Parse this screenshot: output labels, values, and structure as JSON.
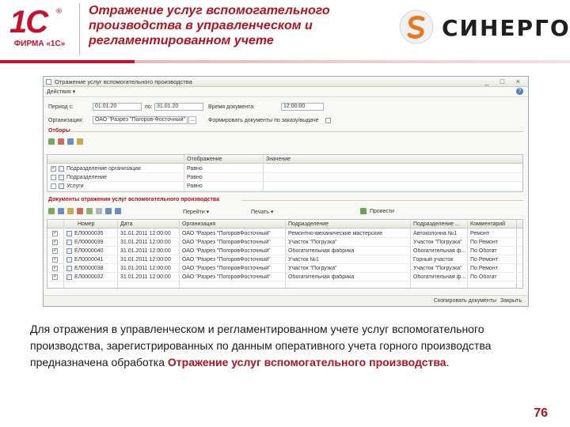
{
  "header": {
    "logo_1c": {
      "mark": "1С",
      "reg": "®",
      "firm": "ФИРМА «1С»"
    },
    "title": "Отражение услуг вспомогательного производства в управленческом и регламентированном учете",
    "partner_logo": "СИНЕРГО"
  },
  "window": {
    "title": "Отражение услуг вспомогательного производства",
    "controls": "_ □ ×",
    "menu_actions": "Действия ▾",
    "help": "?",
    "period_label": "Период с:",
    "period_from": "01.01.20",
    "period_to_label": "по:",
    "period_to": "31.01.20",
    "time_label": "Время документа:",
    "time_value": "12:00:00",
    "org_label": "Организация:",
    "org_value": "ОАО \"Разрез \"Погоров-Фосточный\"",
    "org_button": "...",
    "form_docs_label": "Формировать документы по заказу/выдаче",
    "selections_label": "Отборы",
    "filter_columns": [
      "",
      "Отображение",
      "Значение"
    ],
    "filters": [
      {
        "check": true,
        "name": "Подразделение организации",
        "cond": "Равно",
        "value": ""
      },
      {
        "check": false,
        "name": "Подразделение",
        "cond": "Равно",
        "value": ""
      },
      {
        "check": false,
        "name": "Услуги",
        "cond": "Равно",
        "value": ""
      }
    ],
    "docs_label": "Документы отражения услуг вспомогательного производства",
    "docs_toolbar_items": [
      "Перейти ▾",
      "Печать ▾",
      "Провести"
    ],
    "docs_columns": [
      "",
      "Номер",
      "Дата",
      "Организация",
      "Подразделение",
      "Подразделение ...",
      "Комментарий"
    ],
    "docs": [
      {
        "check": true,
        "number": "ЕЛ0000035",
        "date": "31.01.2011 12:00:00",
        "org": "ОАО \"Разрез \"ПогоровФосточный\"",
        "dept": "Ремонтно-механические мастерские",
        "dept2": "Автоколонна №1",
        "comment": "Ремонт"
      },
      {
        "check": true,
        "number": "ЕЛ0000039",
        "date": "31.01.2011 12:00:00",
        "org": "ОАО \"Разрез \"ПогоровФосточный\"",
        "dept": "Участок \"Погрузка\"",
        "dept2": "Участок \"Погрузка\"",
        "comment": "По Ремонт"
      },
      {
        "check": true,
        "number": "ЕЛ0000040",
        "date": "31.01.2011 12:00:00",
        "org": "ОАО \"Разрез \"ПогоровФосточный\"",
        "dept": "Обогатительная фабрика",
        "dept2": "Обогатительная ф...",
        "comment": "По Обогат"
      },
      {
        "check": true,
        "number": "ЕЛ0000041",
        "date": "31.01.2011 12:00:00",
        "org": "ОАО \"Разрез \"ПогоровФосточный\"",
        "dept": "Участок №1",
        "dept2": "Горный участок",
        "comment": "По Ремонт"
      },
      {
        "check": true,
        "number": "ЕЛ0000038",
        "date": "31.01.2011 12:00:00",
        "org": "ОАО \"Разрез \"ПогоровФосточный\"",
        "dept": "Участок \"Погрузка\"",
        "dept2": "Участок \"Погрузка\"",
        "comment": "По Ремонт"
      },
      {
        "check": true,
        "number": "ЕЛ0000032",
        "date": "31.01.2011 12:00:00",
        "org": "ОАО \"Разрез \"ПогоровФосточный\"",
        "dept": "Обогатительная фабрика",
        "dept2": "Обогатительная ф...",
        "comment": "По Обогат"
      }
    ],
    "copy_docs": "Скопировать документы",
    "close": "Закрыть"
  },
  "caption": {
    "text": "Для отражения в управленческом и регламентированном учете услуг вспомогательного производства, зарегистрированных по данным оперативного учета горного производства предназначена обработка ",
    "highlight": "Отражение услуг вспомогательного производства",
    "tail": "."
  },
  "page_number": "76",
  "colors": {
    "brand_red": "#b3121f",
    "logo_red": "#c8102e",
    "synergo_orange": "#e87722"
  }
}
